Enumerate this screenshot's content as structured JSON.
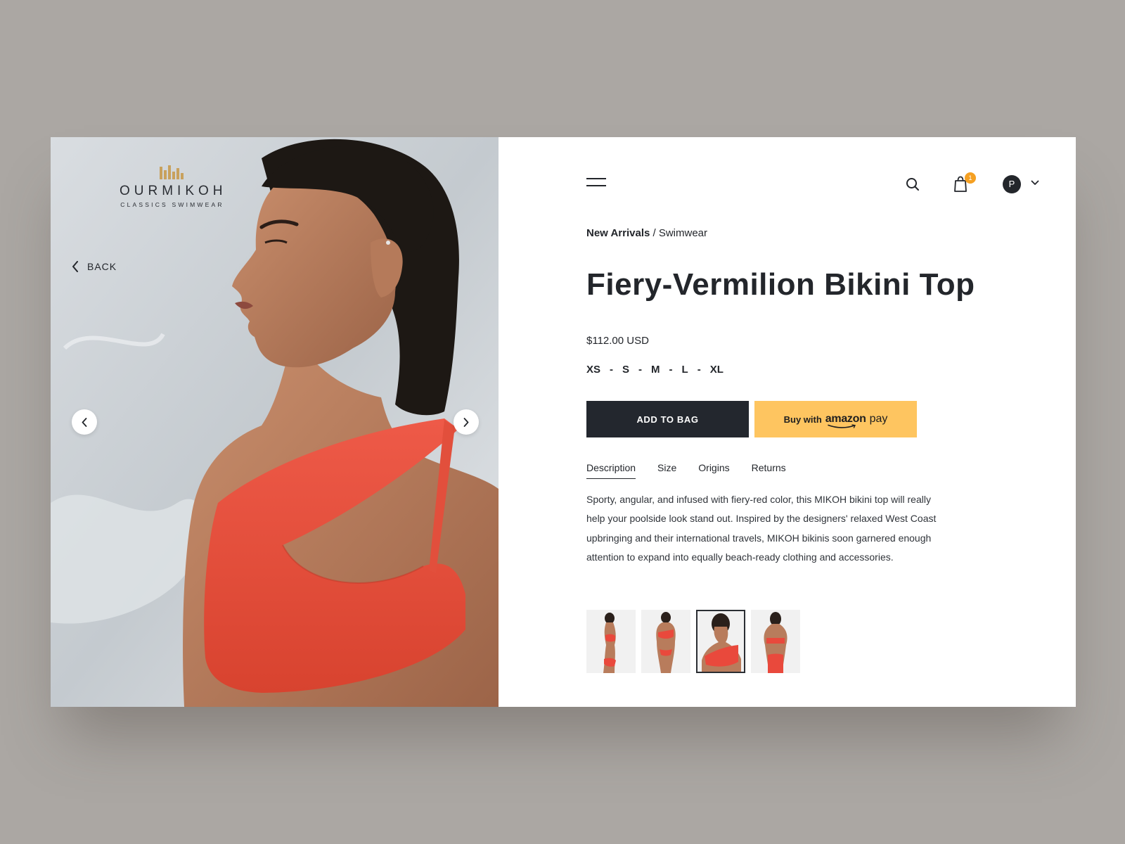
{
  "brand": {
    "name": "OURMIKOH",
    "tagline": "CLASSICS SWIMWEAR",
    "accent_color": "#c8a15d"
  },
  "hero": {
    "back_label": "BACK",
    "prev_icon": "chevron-left-icon",
    "next_icon": "chevron-right-icon"
  },
  "header": {
    "menu_icon": "hamburger-menu-icon",
    "search_icon": "search-icon",
    "cart_icon": "shopping-bag-icon",
    "cart_count": "1",
    "avatar_initial": "P",
    "badge_color": "#f5a022"
  },
  "breadcrumb": {
    "parent": "New Arrivals",
    "separator": "/",
    "current": "Swimwear"
  },
  "product": {
    "title": "Fiery-Vermilion Bikini Top",
    "price": "$112.00 USD",
    "sizes": [
      "XS",
      "S",
      "M",
      "L",
      "XL"
    ],
    "size_separator": "-",
    "add_to_bag_label": "ADD TO BAG",
    "amazon_prefix": "Buy with",
    "amazon_brand": "amazon",
    "amazon_suffix": "pay",
    "amazon_color": "#fec560",
    "primary_color": "#23272e",
    "product_color": "#e9493c"
  },
  "tabs": [
    {
      "label": "Description",
      "active": true
    },
    {
      "label": "Size",
      "active": false
    },
    {
      "label": "Origins",
      "active": false
    },
    {
      "label": "Returns",
      "active": false
    }
  ],
  "description": "Sporty, angular, and infused with fiery-red color, this MIKOH bikini top will really help your poolside look stand out. Inspired by the designers' relaxed West Coast upbringing and their international travels, MIKOH bikinis soon garnered enough attention to expand into equally beach-ready clothing and accessories.",
  "thumbnails": [
    {
      "name": "side-view",
      "selected": false
    },
    {
      "name": "front-view",
      "selected": false
    },
    {
      "name": "close-up-view",
      "selected": true
    },
    {
      "name": "back-view",
      "selected": false
    }
  ]
}
